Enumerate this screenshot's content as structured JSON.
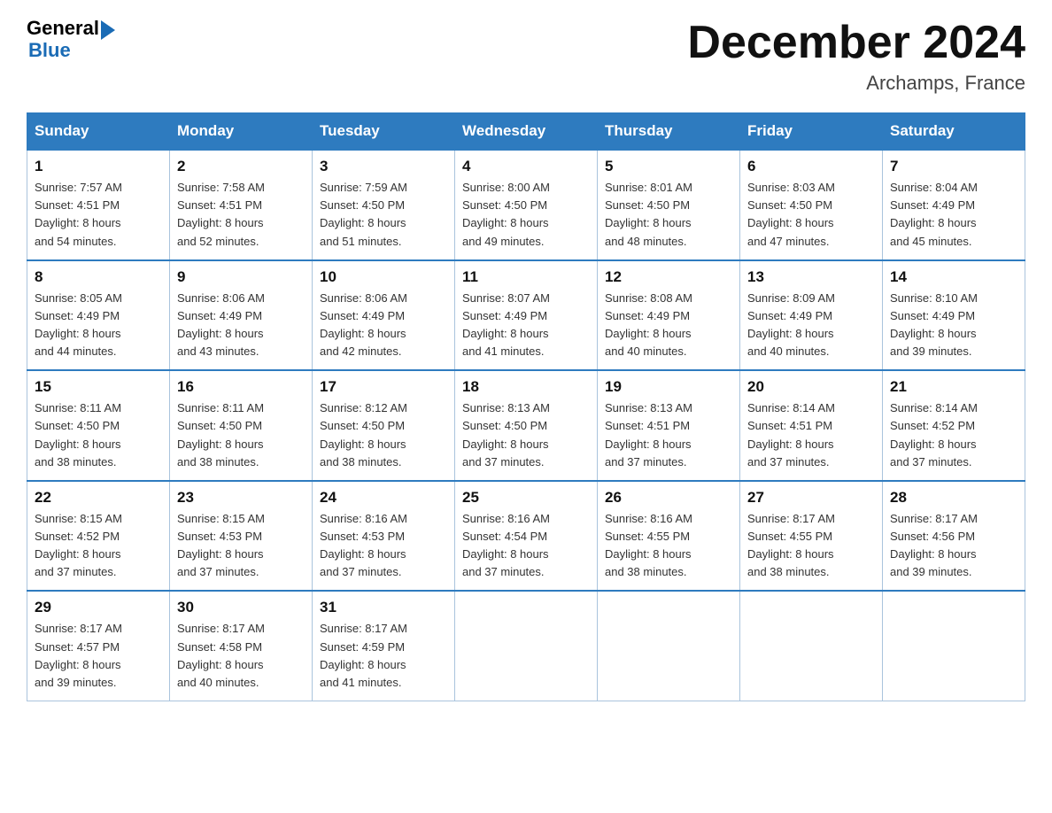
{
  "header": {
    "logo_line1": "General",
    "logo_line2": "Blue",
    "month_title": "December 2024",
    "location": "Archamps, France"
  },
  "days_of_week": [
    "Sunday",
    "Monday",
    "Tuesday",
    "Wednesday",
    "Thursday",
    "Friday",
    "Saturday"
  ],
  "weeks": [
    [
      {
        "day": "1",
        "sunrise": "Sunrise: 7:57 AM",
        "sunset": "Sunset: 4:51 PM",
        "daylight": "Daylight: 8 hours",
        "minutes": "and 54 minutes."
      },
      {
        "day": "2",
        "sunrise": "Sunrise: 7:58 AM",
        "sunset": "Sunset: 4:51 PM",
        "daylight": "Daylight: 8 hours",
        "minutes": "and 52 minutes."
      },
      {
        "day": "3",
        "sunrise": "Sunrise: 7:59 AM",
        "sunset": "Sunset: 4:50 PM",
        "daylight": "Daylight: 8 hours",
        "minutes": "and 51 minutes."
      },
      {
        "day": "4",
        "sunrise": "Sunrise: 8:00 AM",
        "sunset": "Sunset: 4:50 PM",
        "daylight": "Daylight: 8 hours",
        "minutes": "and 49 minutes."
      },
      {
        "day": "5",
        "sunrise": "Sunrise: 8:01 AM",
        "sunset": "Sunset: 4:50 PM",
        "daylight": "Daylight: 8 hours",
        "minutes": "and 48 minutes."
      },
      {
        "day": "6",
        "sunrise": "Sunrise: 8:03 AM",
        "sunset": "Sunset: 4:50 PM",
        "daylight": "Daylight: 8 hours",
        "minutes": "and 47 minutes."
      },
      {
        "day": "7",
        "sunrise": "Sunrise: 8:04 AM",
        "sunset": "Sunset: 4:49 PM",
        "daylight": "Daylight: 8 hours",
        "minutes": "and 45 minutes."
      }
    ],
    [
      {
        "day": "8",
        "sunrise": "Sunrise: 8:05 AM",
        "sunset": "Sunset: 4:49 PM",
        "daylight": "Daylight: 8 hours",
        "minutes": "and 44 minutes."
      },
      {
        "day": "9",
        "sunrise": "Sunrise: 8:06 AM",
        "sunset": "Sunset: 4:49 PM",
        "daylight": "Daylight: 8 hours",
        "minutes": "and 43 minutes."
      },
      {
        "day": "10",
        "sunrise": "Sunrise: 8:06 AM",
        "sunset": "Sunset: 4:49 PM",
        "daylight": "Daylight: 8 hours",
        "minutes": "and 42 minutes."
      },
      {
        "day": "11",
        "sunrise": "Sunrise: 8:07 AM",
        "sunset": "Sunset: 4:49 PM",
        "daylight": "Daylight: 8 hours",
        "minutes": "and 41 minutes."
      },
      {
        "day": "12",
        "sunrise": "Sunrise: 8:08 AM",
        "sunset": "Sunset: 4:49 PM",
        "daylight": "Daylight: 8 hours",
        "minutes": "and 40 minutes."
      },
      {
        "day": "13",
        "sunrise": "Sunrise: 8:09 AM",
        "sunset": "Sunset: 4:49 PM",
        "daylight": "Daylight: 8 hours",
        "minutes": "and 40 minutes."
      },
      {
        "day": "14",
        "sunrise": "Sunrise: 8:10 AM",
        "sunset": "Sunset: 4:49 PM",
        "daylight": "Daylight: 8 hours",
        "minutes": "and 39 minutes."
      }
    ],
    [
      {
        "day": "15",
        "sunrise": "Sunrise: 8:11 AM",
        "sunset": "Sunset: 4:50 PM",
        "daylight": "Daylight: 8 hours",
        "minutes": "and 38 minutes."
      },
      {
        "day": "16",
        "sunrise": "Sunrise: 8:11 AM",
        "sunset": "Sunset: 4:50 PM",
        "daylight": "Daylight: 8 hours",
        "minutes": "and 38 minutes."
      },
      {
        "day": "17",
        "sunrise": "Sunrise: 8:12 AM",
        "sunset": "Sunset: 4:50 PM",
        "daylight": "Daylight: 8 hours",
        "minutes": "and 38 minutes."
      },
      {
        "day": "18",
        "sunrise": "Sunrise: 8:13 AM",
        "sunset": "Sunset: 4:50 PM",
        "daylight": "Daylight: 8 hours",
        "minutes": "and 37 minutes."
      },
      {
        "day": "19",
        "sunrise": "Sunrise: 8:13 AM",
        "sunset": "Sunset: 4:51 PM",
        "daylight": "Daylight: 8 hours",
        "minutes": "and 37 minutes."
      },
      {
        "day": "20",
        "sunrise": "Sunrise: 8:14 AM",
        "sunset": "Sunset: 4:51 PM",
        "daylight": "Daylight: 8 hours",
        "minutes": "and 37 minutes."
      },
      {
        "day": "21",
        "sunrise": "Sunrise: 8:14 AM",
        "sunset": "Sunset: 4:52 PM",
        "daylight": "Daylight: 8 hours",
        "minutes": "and 37 minutes."
      }
    ],
    [
      {
        "day": "22",
        "sunrise": "Sunrise: 8:15 AM",
        "sunset": "Sunset: 4:52 PM",
        "daylight": "Daylight: 8 hours",
        "minutes": "and 37 minutes."
      },
      {
        "day": "23",
        "sunrise": "Sunrise: 8:15 AM",
        "sunset": "Sunset: 4:53 PM",
        "daylight": "Daylight: 8 hours",
        "minutes": "and 37 minutes."
      },
      {
        "day": "24",
        "sunrise": "Sunrise: 8:16 AM",
        "sunset": "Sunset: 4:53 PM",
        "daylight": "Daylight: 8 hours",
        "minutes": "and 37 minutes."
      },
      {
        "day": "25",
        "sunrise": "Sunrise: 8:16 AM",
        "sunset": "Sunset: 4:54 PM",
        "daylight": "Daylight: 8 hours",
        "minutes": "and 37 minutes."
      },
      {
        "day": "26",
        "sunrise": "Sunrise: 8:16 AM",
        "sunset": "Sunset: 4:55 PM",
        "daylight": "Daylight: 8 hours",
        "minutes": "and 38 minutes."
      },
      {
        "day": "27",
        "sunrise": "Sunrise: 8:17 AM",
        "sunset": "Sunset: 4:55 PM",
        "daylight": "Daylight: 8 hours",
        "minutes": "and 38 minutes."
      },
      {
        "day": "28",
        "sunrise": "Sunrise: 8:17 AM",
        "sunset": "Sunset: 4:56 PM",
        "daylight": "Daylight: 8 hours",
        "minutes": "and 39 minutes."
      }
    ],
    [
      {
        "day": "29",
        "sunrise": "Sunrise: 8:17 AM",
        "sunset": "Sunset: 4:57 PM",
        "daylight": "Daylight: 8 hours",
        "minutes": "and 39 minutes."
      },
      {
        "day": "30",
        "sunrise": "Sunrise: 8:17 AM",
        "sunset": "Sunset: 4:58 PM",
        "daylight": "Daylight: 8 hours",
        "minutes": "and 40 minutes."
      },
      {
        "day": "31",
        "sunrise": "Sunrise: 8:17 AM",
        "sunset": "Sunset: 4:59 PM",
        "daylight": "Daylight: 8 hours",
        "minutes": "and 41 minutes."
      },
      null,
      null,
      null,
      null
    ]
  ]
}
